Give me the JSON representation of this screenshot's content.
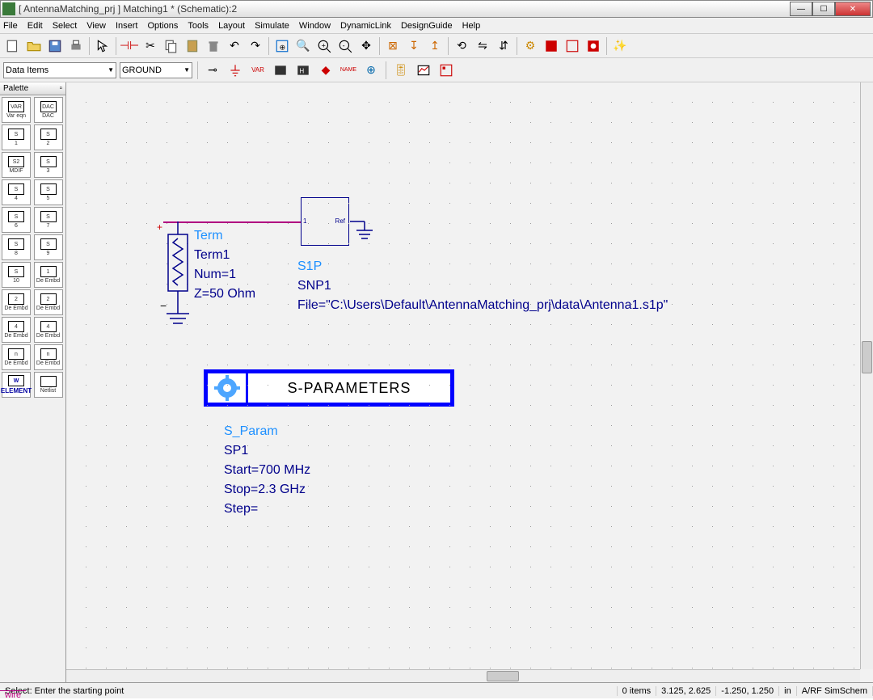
{
  "title": "[ AntennaMatching_prj ] Matching1 * (Schematic):2",
  "menu": [
    "File",
    "Edit",
    "Select",
    "View",
    "Insert",
    "Options",
    "Tools",
    "Layout",
    "Simulate",
    "Window",
    "DynamicLink",
    "DesignGuide",
    "Help"
  ],
  "combo": {
    "category": "Data Items",
    "component": "GROUND"
  },
  "palette_title": "Palette",
  "palette": [
    {
      "top": "VAR",
      "bot": "Var eqn"
    },
    {
      "top": "DAC",
      "bot": "DAC"
    },
    {
      "top": "S",
      "bot": "1"
    },
    {
      "top": "S",
      "bot": "2"
    },
    {
      "top": "S2",
      "bot": "MDIF"
    },
    {
      "top": "S",
      "bot": "3"
    },
    {
      "top": "S",
      "bot": "4"
    },
    {
      "top": "S",
      "bot": "5"
    },
    {
      "top": "S",
      "bot": "6"
    },
    {
      "top": "S",
      "bot": "7"
    },
    {
      "top": "S",
      "bot": "8"
    },
    {
      "top": "S",
      "bot": "9"
    },
    {
      "top": "S",
      "bot": "10"
    },
    {
      "top": "1",
      "bot": "De Embd"
    },
    {
      "top": "2",
      "bot": "De Embd"
    },
    {
      "top": "2",
      "bot": "De Embd"
    },
    {
      "top": "4",
      "bot": "De Embd"
    },
    {
      "top": "4",
      "bot": "De Embd"
    },
    {
      "top": "n",
      "bot": "De Embd"
    },
    {
      "top": "n",
      "bot": "De Embd"
    },
    {
      "top": "W",
      "bot": "ELEMENT"
    },
    {
      "top": "",
      "bot": "Netlist"
    }
  ],
  "term": {
    "type": "Term",
    "name": "Term1",
    "num": "Num=1",
    "z": "Z=50 Ohm"
  },
  "s1p": {
    "type": "S1P",
    "name": "SNP1",
    "file": "File=\"C:\\Users\\Default\\AntennaMatching_prj\\data\\Antenna1.s1p\""
  },
  "sparam": {
    "title": "S-PARAMETERS",
    "type": "S_Param",
    "name": "SP1",
    "start": "Start=700 MHz",
    "stop": "Stop=2.3 GHz",
    "step": "Step="
  },
  "status": {
    "hint": "Select: Enter the starting point",
    "items": "0 items",
    "mode": "wire",
    "coord1": "3.125, 2.625",
    "coord2": "-1.250, 1.250",
    "unit": "in",
    "sim": "A/RF  SimSchem"
  }
}
